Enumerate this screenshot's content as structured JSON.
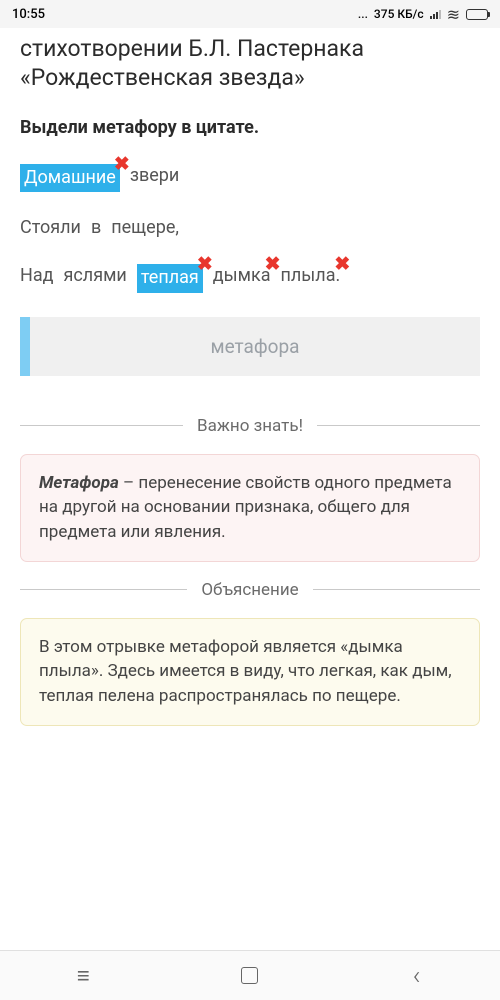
{
  "status": {
    "time": "10:55",
    "net_speed": "375 КБ/с",
    "dots": "..."
  },
  "title": "стихотворении Б.Л. Пастернака «Рождественская звезда»",
  "instruction": "Выдели метафору в цитате.",
  "poem": {
    "line1": {
      "w1": "Домашние",
      "w2": "звери"
    },
    "line2": {
      "w1": "Стояли",
      "w2": "в",
      "w3": "пещере,"
    },
    "line3": {
      "w1": "Над",
      "w2": "яслями",
      "w3": "теплая",
      "w4": "дымка",
      "w5": "плыла."
    }
  },
  "metaphor_label": "метафора",
  "important": {
    "heading": "Важно знать!",
    "term": "Метафора",
    "text": " – перенесение свойств одного предмета на другой на основании признака, общего для предмета или явления."
  },
  "explanation": {
    "heading": "Объяснение",
    "text": "В этом отрывке метафорой является «дымка плыла». Здесь имеется в виду, что легкая, как дым, теплая пелена распространялась по пещере."
  }
}
